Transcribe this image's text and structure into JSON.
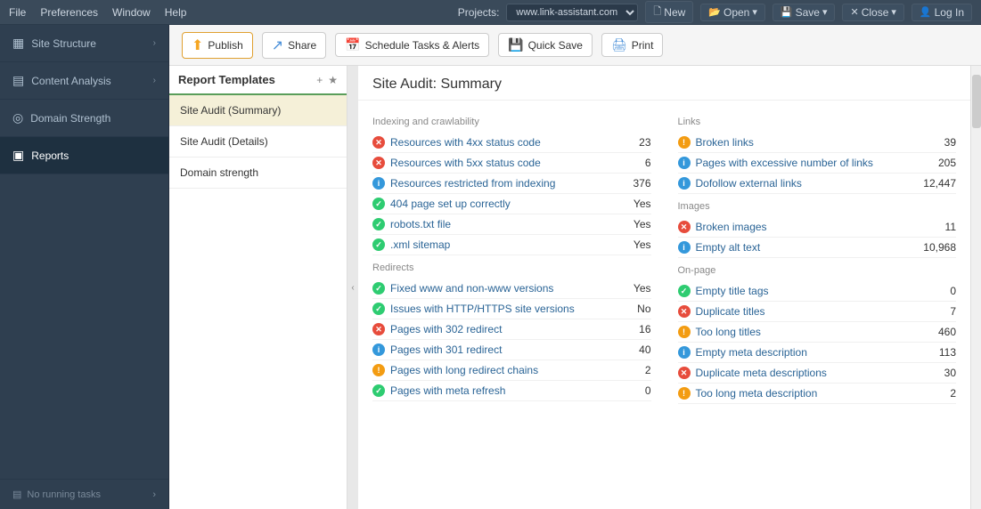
{
  "menubar": {
    "items": [
      "File",
      "Preferences",
      "Window",
      "Help"
    ],
    "projects_label": "Projects:",
    "project_url": "www.link-assistant.com",
    "buttons": [
      "New",
      "Open",
      "Save",
      "Close",
      "Log In"
    ]
  },
  "toolbar": {
    "publish_label": "Publish",
    "share_label": "Share",
    "schedule_label": "Schedule Tasks & Alerts",
    "quicksave_label": "Quick Save",
    "print_label": "Print"
  },
  "sidebar": {
    "items": [
      {
        "id": "site-structure",
        "label": "Site Structure",
        "icon": "▦"
      },
      {
        "id": "content-analysis",
        "label": "Content Analysis",
        "icon": "▤"
      },
      {
        "id": "domain-strength",
        "label": "Domain Strength",
        "icon": "◎"
      },
      {
        "id": "reports",
        "label": "Reports",
        "icon": "▣"
      }
    ],
    "bottom_label": "No running tasks"
  },
  "templates": {
    "title": "Report Templates",
    "items": [
      {
        "id": "site-audit-summary",
        "label": "Site Audit (Summary)",
        "active": true
      },
      {
        "id": "site-audit-details",
        "label": "Site Audit (Details)",
        "active": false
      },
      {
        "id": "domain-strength",
        "label": "Domain strength",
        "active": false
      }
    ]
  },
  "report": {
    "title": "Site Audit: Summary",
    "sections": {
      "indexing": {
        "title": "Indexing and crawlability",
        "rows": [
          {
            "status": "red",
            "label": "Resources with 4xx status code",
            "value": "23"
          },
          {
            "status": "red",
            "label": "Resources with 5xx status code",
            "value": "6"
          },
          {
            "status": "blue",
            "label": "Resources restricted from indexing",
            "value": "376"
          },
          {
            "status": "green",
            "label": "404 page set up correctly",
            "value": "Yes"
          },
          {
            "status": "green",
            "label": "robots.txt file",
            "value": "Yes"
          },
          {
            "status": "green",
            "label": ".xml sitemap",
            "value": "Yes"
          }
        ]
      },
      "redirects": {
        "title": "Redirects",
        "rows": [
          {
            "status": "green",
            "label": "Fixed www and non-www versions",
            "value": "Yes"
          },
          {
            "status": "green",
            "label": "Issues with HTTP/HTTPS site versions",
            "value": "No"
          },
          {
            "status": "red",
            "label": "Pages with 302 redirect",
            "value": "16"
          },
          {
            "status": "blue",
            "label": "Pages with 301 redirect",
            "value": "40"
          },
          {
            "status": "orange",
            "label": "Pages with long redirect chains",
            "value": "2"
          },
          {
            "status": "green",
            "label": "Pages with meta refresh",
            "value": "0"
          }
        ]
      },
      "links": {
        "title": "Links",
        "rows": [
          {
            "status": "orange",
            "label": "Broken links",
            "value": "39"
          },
          {
            "status": "blue",
            "label": "Pages with excessive number of links",
            "value": "205"
          },
          {
            "status": "blue",
            "label": "Dofollow external links",
            "value": "12,447"
          }
        ]
      },
      "images": {
        "title": "Images",
        "rows": [
          {
            "status": "red",
            "label": "Broken images",
            "value": "11"
          },
          {
            "status": "blue",
            "label": "Empty alt text",
            "value": "10,968"
          }
        ]
      },
      "onpage": {
        "title": "On-page",
        "rows": [
          {
            "status": "green",
            "label": "Empty title tags",
            "value": "0"
          },
          {
            "status": "red",
            "label": "Duplicate titles",
            "value": "7"
          },
          {
            "status": "orange",
            "label": "Too long titles",
            "value": "460"
          },
          {
            "status": "blue",
            "label": "Empty meta description",
            "value": "113"
          },
          {
            "status": "red",
            "label": "Duplicate meta descriptions",
            "value": "30"
          },
          {
            "status": "orange",
            "label": "Too long meta description",
            "value": "2"
          }
        ]
      }
    }
  },
  "icons": {
    "chevron_right": "›",
    "plus": "+",
    "star": "★",
    "collapse": "‹",
    "no_tasks": "▤",
    "chevron_expand": "▾"
  }
}
